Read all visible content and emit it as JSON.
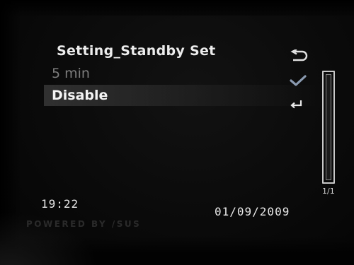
{
  "menu": {
    "title": "Setting_Standby Set",
    "items": [
      {
        "label": "5 min",
        "state": "checked"
      },
      {
        "label": "Disable",
        "state": "highlighted"
      }
    ]
  },
  "icons": {
    "back": "back-arrow-icon",
    "check": "checkmark-icon",
    "enter": "enter-icon"
  },
  "pagination": {
    "indicator": "1/1"
  },
  "status": {
    "time": "19:22",
    "date": "01/09/2009"
  },
  "branding": {
    "text": "POWERED BY /SUS"
  },
  "colors": {
    "background": "#0a0a0a",
    "text_primary": "#f4f4f4",
    "text_dim": "#7d7d7d",
    "highlight": "#505050",
    "checkmark": "#8a9ab0"
  }
}
